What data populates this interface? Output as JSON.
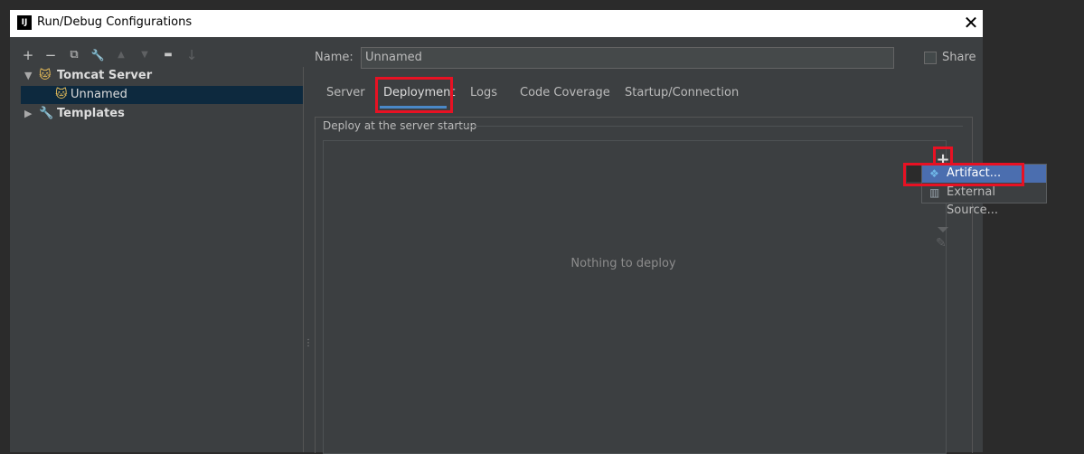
{
  "window": {
    "title": "Run/Debug Configurations",
    "app_icon": "IJ",
    "close": "✕"
  },
  "toolbar": [
    {
      "icon": "add-icon",
      "glyph": "+"
    },
    {
      "icon": "remove-icon",
      "glyph": "−"
    },
    {
      "icon": "copy-icon",
      "glyph": "⧉"
    },
    {
      "icon": "wrench-icon",
      "glyph": "🔧"
    },
    {
      "icon": "move-up-icon",
      "glyph": "▲"
    },
    {
      "icon": "move-down-icon",
      "glyph": "▼"
    },
    {
      "icon": "folder-icon",
      "glyph": "▬"
    },
    {
      "icon": "sort-icon",
      "glyph": "↓"
    }
  ],
  "tree": {
    "tomcat": {
      "label": "Tomcat Server",
      "expanded": true
    },
    "unnamed": {
      "label": "Unnamed"
    },
    "templates": {
      "label": "Templates",
      "expanded": false
    }
  },
  "form": {
    "name_label": "Name:",
    "name_value": "Unnamed",
    "share_label": "Share"
  },
  "tabs": [
    "Server",
    "Deployment",
    "Logs",
    "Code Coverage",
    "Startup/Connection"
  ],
  "active_tab": "Deployment",
  "deploy": {
    "section_title": "Deploy at the server startup",
    "empty_text": "Nothing to deploy"
  },
  "popup_menu": {
    "items": [
      {
        "label": "Artifact...",
        "icon": "artifact-icon",
        "selected": true
      },
      {
        "label": "External Source...",
        "icon": "external-source-icon",
        "selected": false
      }
    ]
  },
  "colors": {
    "background": "#3c3f41",
    "highlight": "#e81123",
    "selection": "#0d293e",
    "menu_selection": "#4b6eaf",
    "tab_underline": "#4a88c7"
  }
}
